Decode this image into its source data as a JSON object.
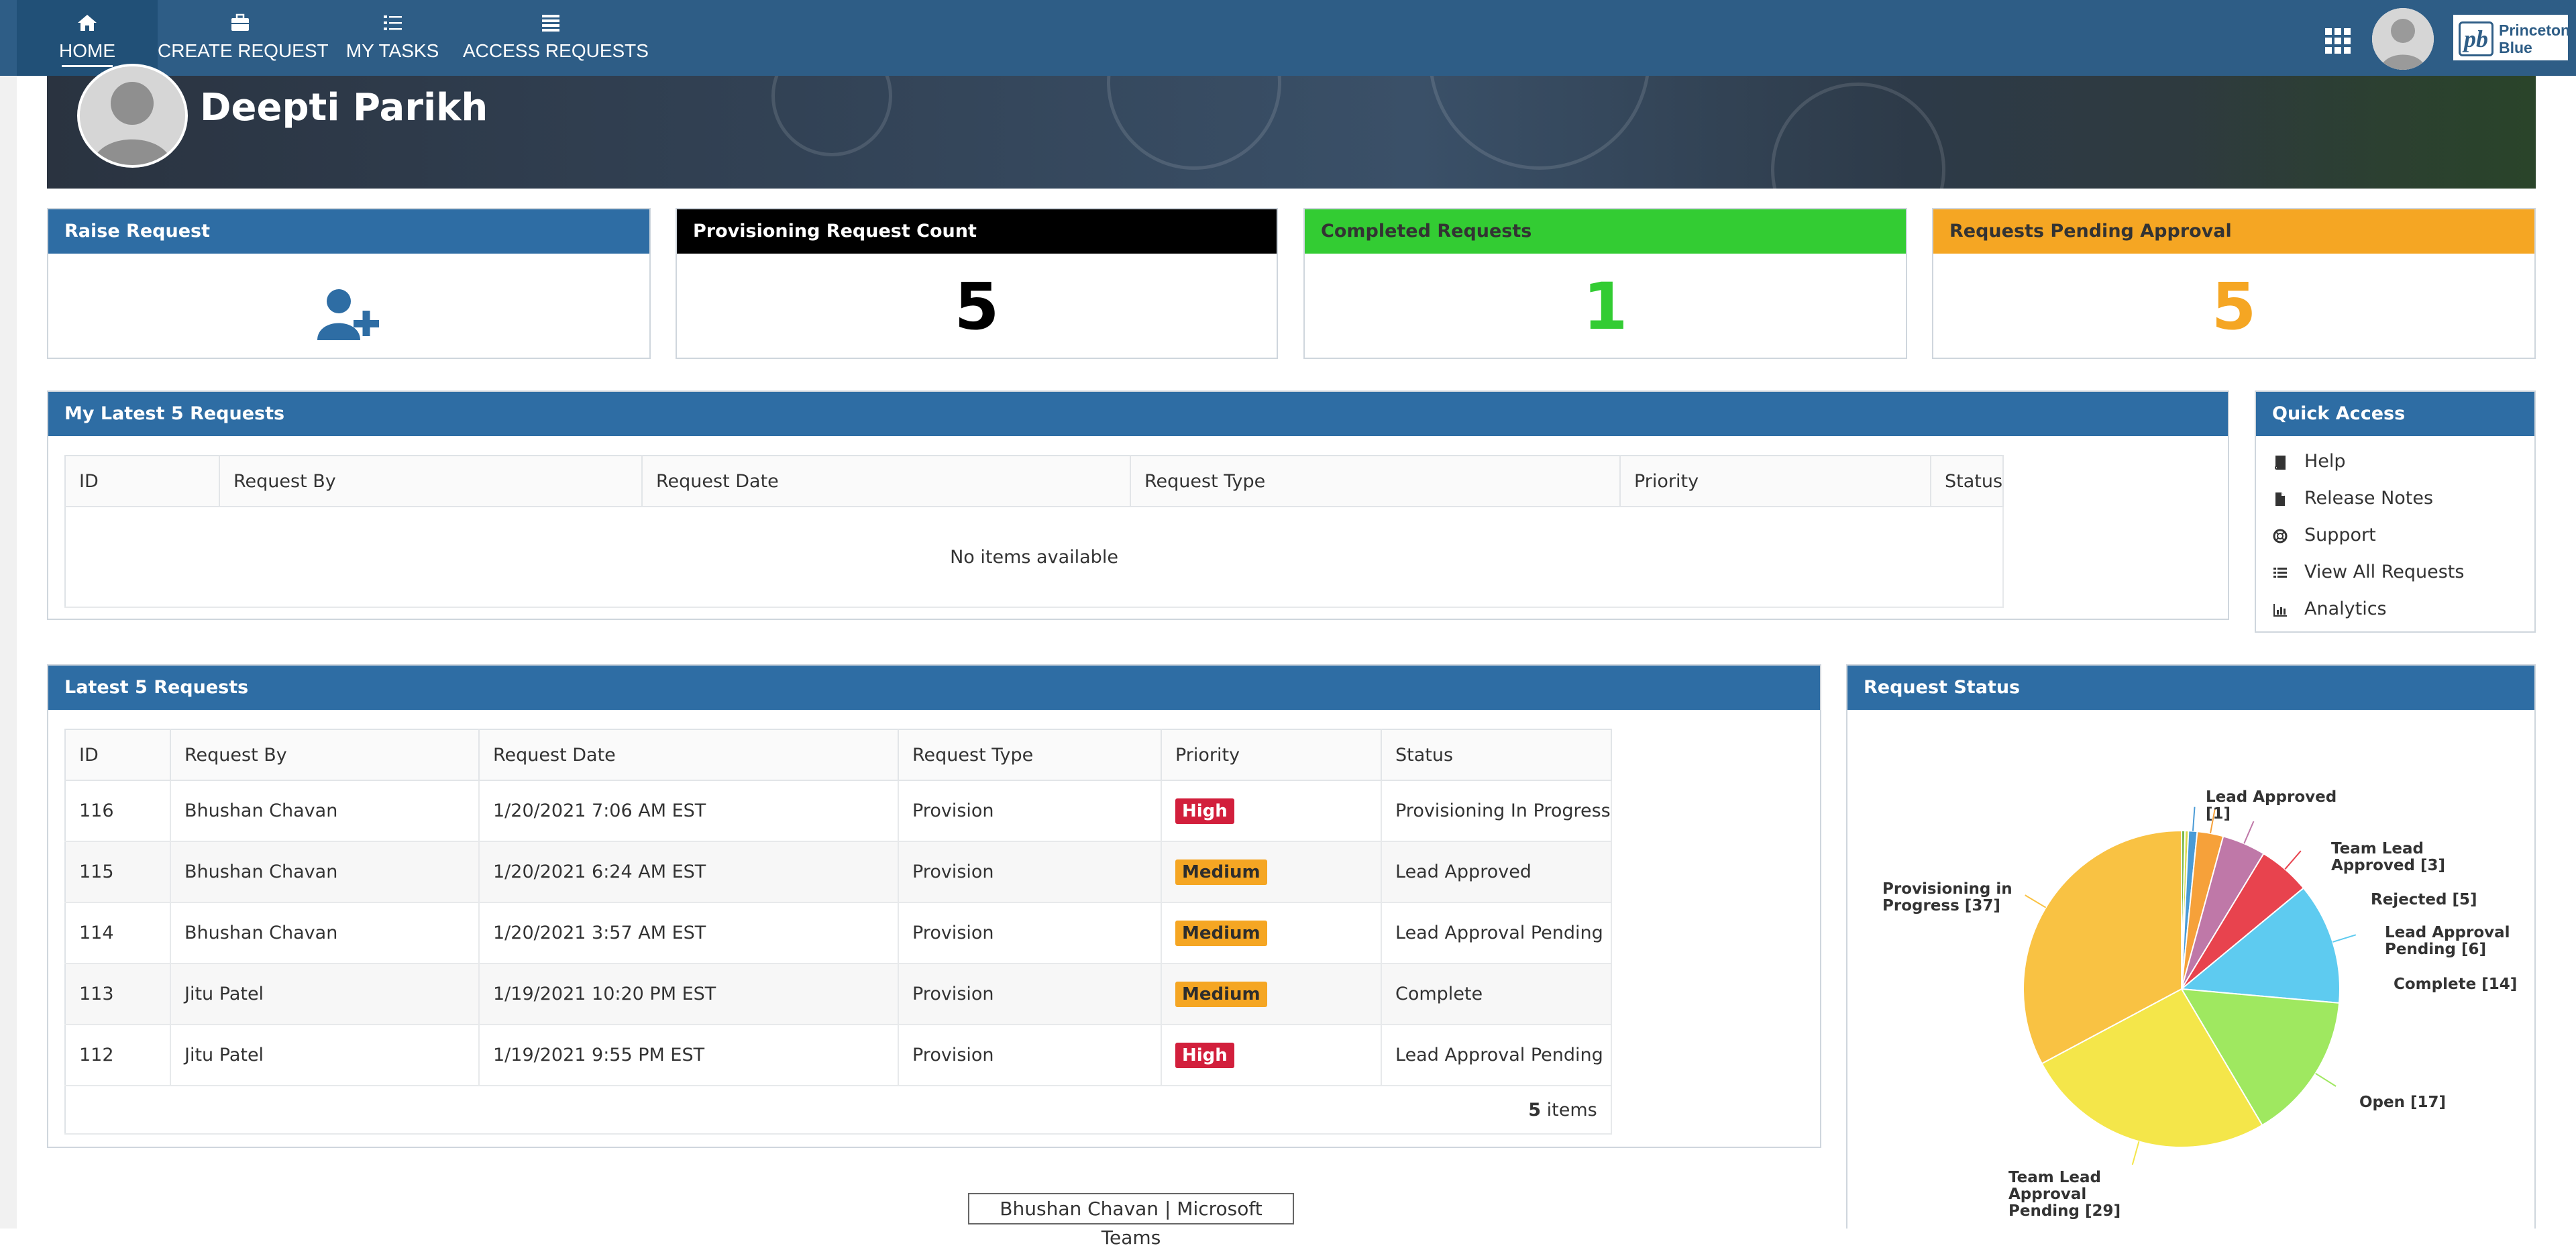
{
  "nav": {
    "items": [
      {
        "label": "HOME",
        "icon": "home-icon"
      },
      {
        "label": "CREATE REQUEST",
        "icon": "briefcase-icon"
      },
      {
        "label": "MY TASKS",
        "icon": "task-list-icon"
      },
      {
        "label": "ACCESS REQUESTS",
        "icon": "list-icon"
      }
    ],
    "logo_mark": "pb",
    "logo_text_1": "Princeton",
    "logo_text_2": "Blue"
  },
  "user": {
    "name": "Deepti Parikh"
  },
  "cards": [
    {
      "title": "Raise Request",
      "icon": "add-user-icon",
      "header_color": "#2e6da4"
    },
    {
      "title": "Provisioning Request Count",
      "value": "5",
      "header_color": "#000000",
      "value_color": "#000000"
    },
    {
      "title": "Completed Requests",
      "value": "1",
      "header_color": "#33cc33",
      "value_color": "#33cc33"
    },
    {
      "title": "Requests Pending Approval",
      "value": "5",
      "header_color": "#f5a623",
      "value_color": "#f5a623"
    }
  ],
  "my_latest": {
    "title": "My Latest 5 Requests",
    "columns": [
      "ID",
      "Request By",
      "Request Date",
      "Request Type",
      "Priority",
      "Status"
    ],
    "empty_text": "No items available"
  },
  "quick_access": {
    "title": "Quick Access",
    "items": [
      {
        "label": "Help",
        "icon": "book-icon"
      },
      {
        "label": "Release Notes",
        "icon": "file-icon"
      },
      {
        "label": "Support",
        "icon": "lifebuoy-icon"
      },
      {
        "label": "View All Requests",
        "icon": "list-icon"
      },
      {
        "label": "Analytics",
        "icon": "bar-chart-icon"
      }
    ]
  },
  "latest": {
    "title": "Latest 5 Requests",
    "columns": [
      "ID",
      "Request By",
      "Request Date",
      "Request Type",
      "Priority",
      "Status"
    ],
    "rows": [
      {
        "id": "116",
        "by": "Bhushan Chavan",
        "date": "1/20/2021 7:06 AM EST",
        "type": "Provision",
        "priority": "High",
        "status": "Provisioning In Progress"
      },
      {
        "id": "115",
        "by": "Bhushan Chavan",
        "date": "1/20/2021 6:24 AM EST",
        "type": "Provision",
        "priority": "Medium",
        "status": "Lead Approved"
      },
      {
        "id": "114",
        "by": "Bhushan Chavan",
        "date": "1/20/2021 3:57 AM EST",
        "type": "Provision",
        "priority": "Medium",
        "status": "Lead Approval Pending"
      },
      {
        "id": "113",
        "by": "Jitu Patel",
        "date": "1/19/2021 10:20 PM EST",
        "type": "Provision",
        "priority": "Medium",
        "status": "Complete"
      },
      {
        "id": "112",
        "by": "Jitu Patel",
        "date": "1/19/2021 9:55 PM EST",
        "type": "Provision",
        "priority": "High",
        "status": "Lead Approval Pending"
      }
    ],
    "footer_count": "5",
    "footer_suffix": "items"
  },
  "request_status": {
    "title": "Request Status"
  },
  "chart_data": {
    "type": "pie",
    "title": "",
    "slices": [
      {
        "label": "Lead Approved",
        "value": 1,
        "color": "#4a9bd6"
      },
      {
        "label": "Team Lead Approved",
        "value": 3,
        "color": "#f6a13a"
      },
      {
        "label": "Rejected",
        "value": 5,
        "color": "#bf78a8"
      },
      {
        "label": "Lead Approval Pending",
        "value": 6,
        "color": "#e8434e"
      },
      {
        "label": "Complete",
        "value": 14,
        "color": "#5ecbf0"
      },
      {
        "label": "Open",
        "value": 17,
        "color": "#9fe860"
      },
      {
        "label": "Team Lead Approval Pending",
        "value": 29,
        "color": "#f4e64a"
      },
      {
        "label": "Provisioning in Progress",
        "value": 37,
        "color": "#f9c243"
      }
    ],
    "extra_colors": [
      "#79b84a",
      "#d9d94a"
    ]
  },
  "tooltip": "Bhushan Chavan | Microsoft Teams"
}
